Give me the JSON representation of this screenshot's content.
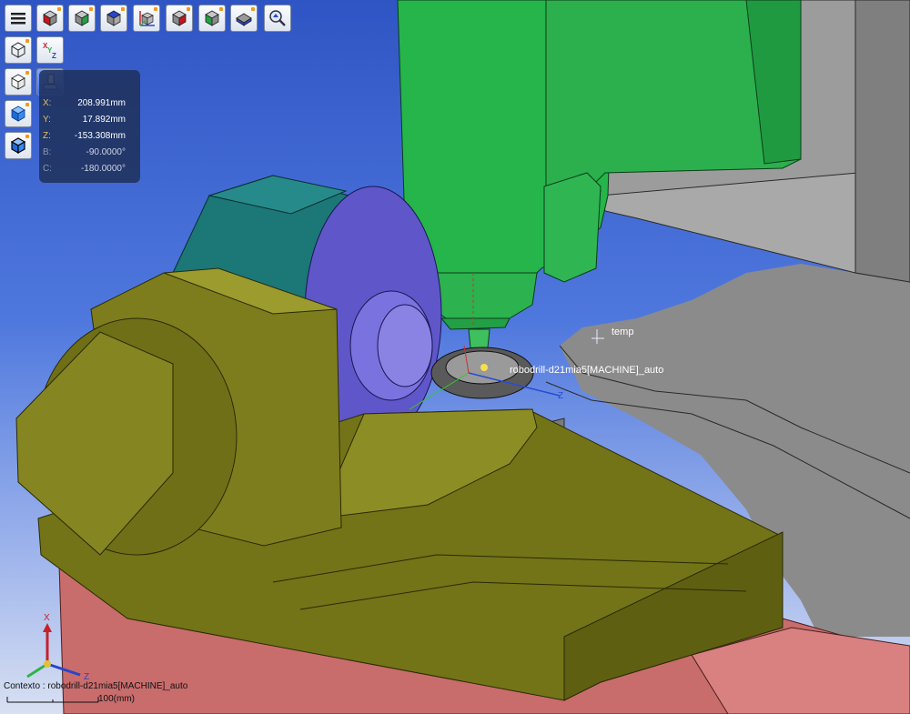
{
  "toolbar": {
    "row1": [
      {
        "name": "menu-icon",
        "label": "Menu"
      },
      {
        "name": "view-front-icon"
      },
      {
        "name": "view-right-icon"
      },
      {
        "name": "view-top-icon"
      },
      {
        "name": "view-axes-icon"
      },
      {
        "name": "view-back-icon"
      },
      {
        "name": "view-left-icon"
      },
      {
        "name": "view-bottom-icon"
      },
      {
        "name": "zoom-fit-icon"
      }
    ],
    "row2": [
      {
        "name": "wireframe-cube-icon"
      },
      {
        "name": "xyz-axes-icon"
      }
    ],
    "sidebar": [
      {
        "name": "outline-cube-icon"
      },
      {
        "name": "shaded-cube-icon"
      },
      {
        "name": "shaded-edges-cube-icon"
      },
      {
        "name": "tool-probe-icon"
      }
    ]
  },
  "coordinates": {
    "x": {
      "label": "X:",
      "value": "208.991mm"
    },
    "y": {
      "label": "Y:",
      "value": "17.892mm"
    },
    "z": {
      "label": "Z:",
      "value": "-153.308mm"
    },
    "b": {
      "label": "B:",
      "value": "-90.0000°"
    },
    "c": {
      "label": "C:",
      "value": "-180.0000°"
    }
  },
  "scene": {
    "labels": {
      "temp": "temp",
      "machine": "robodrill-d21mia5[MACHINE]_auto"
    },
    "triad": {
      "x": "X",
      "y": "Y",
      "z": "Z"
    }
  },
  "status": {
    "context": "Contexto : robodrill-d21mia5[MACHINE]_auto",
    "scale": "100(mm)"
  },
  "colors": {
    "background_top": "#2f55c4",
    "machine_body": "#8a8a8a",
    "spindle": "#25b54a",
    "rotary_table": "#7a7a1c",
    "pedestal": "#c86a6a",
    "trunnion": "#1c7a7a",
    "faceplate": "#6b63d6"
  }
}
